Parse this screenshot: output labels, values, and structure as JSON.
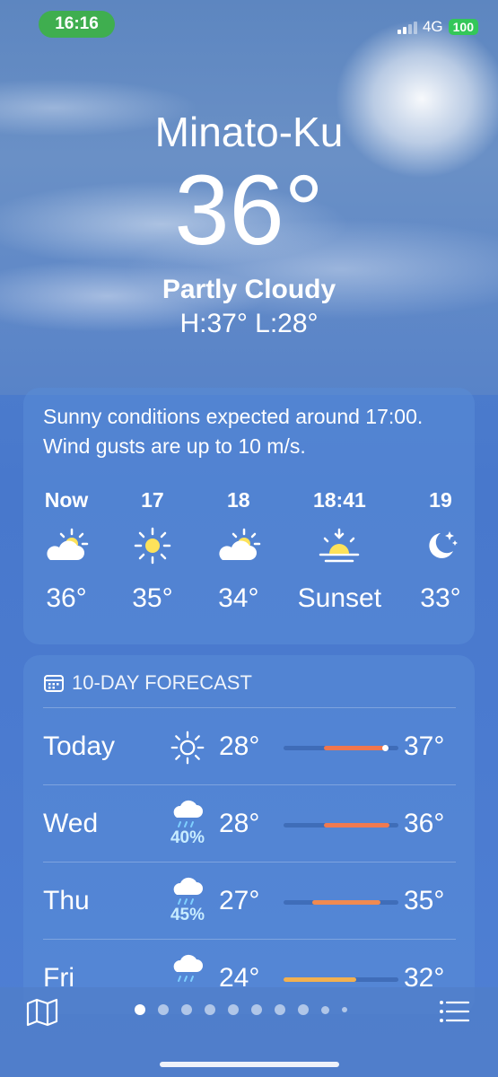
{
  "status": {
    "time": "16:16",
    "network": "4G",
    "battery": "100"
  },
  "location": {
    "city": "Minato-Ku",
    "temperature": "36°",
    "condition": "Partly Cloudy",
    "high_low": "H:37°  L:28°"
  },
  "hourly": {
    "summary": "Sunny conditions expected around 17:00. Wind gusts are up to 10 m/s.",
    "items": [
      {
        "label": "Now",
        "icon": "partly-cloudy-icon",
        "value": "36°"
      },
      {
        "label": "17",
        "icon": "sun-icon",
        "value": "35°"
      },
      {
        "label": "18",
        "icon": "partly-cloudy-icon",
        "value": "34°"
      },
      {
        "label": "18:41",
        "icon": "sunset-icon",
        "value": "Sunset"
      },
      {
        "label": "19",
        "icon": "moon-stars-icon",
        "value": "33°"
      }
    ]
  },
  "forecast": {
    "title": "10-DAY FORECAST",
    "days": [
      {
        "day": "Today",
        "icon": "sun-icon",
        "precip": "",
        "low": "28°",
        "high": "37°",
        "bar_start": 0.35,
        "bar_end": 0.9,
        "bar_color": "#f0764e",
        "current_marker": true
      },
      {
        "day": "Wed",
        "icon": "rain-cloud-icon",
        "precip": "40%",
        "low": "28°",
        "high": "36°",
        "bar_start": 0.35,
        "bar_end": 0.92,
        "bar_color": "#f07a50",
        "current_marker": false
      },
      {
        "day": "Thu",
        "icon": "rain-cloud-icon",
        "precip": "45%",
        "low": "27°",
        "high": "35°",
        "bar_start": 0.25,
        "bar_end": 0.84,
        "bar_color": "#f08a50",
        "current_marker": false
      },
      {
        "day": "Fri",
        "icon": "rain-cloud-icon",
        "precip": "",
        "low": "24°",
        "high": "32°",
        "bar_start": 0.0,
        "bar_end": 0.63,
        "bar_color": "#f2b050",
        "current_marker": false
      }
    ]
  },
  "bottom": {
    "page_count": 10,
    "active_page": 0
  }
}
